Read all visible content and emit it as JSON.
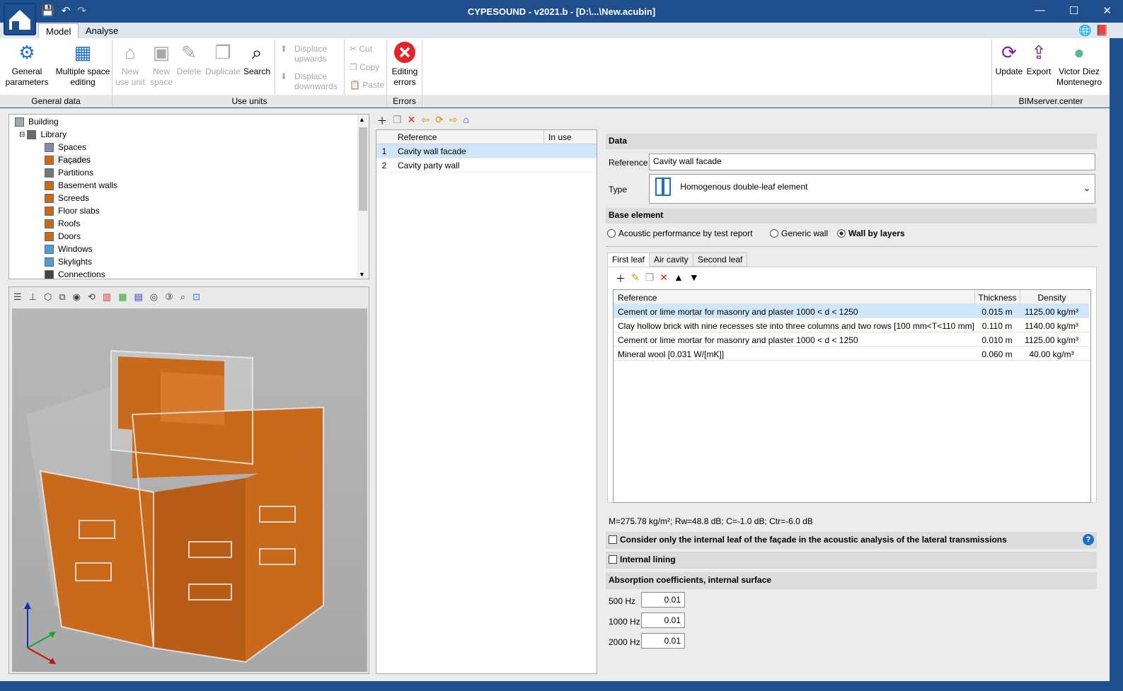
{
  "title": "CYPESOUND - v2021.b - [D:\\...\\New.acubin]",
  "window_buttons": {
    "minimize": "—",
    "maximize": "☐",
    "close": "✕"
  },
  "ribbon_tabs": [
    "Model",
    "Analyse"
  ],
  "ribbon": {
    "general_parameters": "General parameters",
    "multiple_space_editing": "Multiple space editing",
    "new_use_unit": "New use unit",
    "new_space": "New space",
    "delete": "Delete",
    "duplicate": "Duplicate",
    "search": "Search",
    "displace_upwards": "Displace upwards",
    "displace_downwards": "Displace downwards",
    "cut": "Cut",
    "copy": "Copy",
    "paste": "Paste",
    "editing_errors": "Editing errors",
    "update": "Update",
    "export": "Export",
    "user": "Victor Diez Montenegro",
    "groups": [
      "General data",
      "Use units",
      "Errors",
      "BIMserver.center"
    ]
  },
  "tree": {
    "root": "Building",
    "library": "Library",
    "items": [
      "Spaces",
      "Façades",
      "Partitions",
      "Basement walls",
      "Screeds",
      "Floor slabs",
      "Roofs",
      "Doors",
      "Windows",
      "Skylights",
      "Connections"
    ]
  },
  "list": {
    "headers": [
      "Reference",
      "In use"
    ],
    "rows": [
      {
        "n": "1",
        "ref": "Cavity wall facade"
      },
      {
        "n": "2",
        "ref": "Cavity party wall"
      }
    ]
  },
  "data": {
    "section": "Data",
    "reference_label": "Reference",
    "reference_value": "Cavity wall facade",
    "type_label": "Type",
    "type_value": "Homogenous double-leaf element",
    "base_section": "Base element",
    "options": [
      "Acoustic performance by test report",
      "Generic wall",
      "Wall by layers"
    ],
    "leaf_tabs": [
      "First leaf",
      "Air cavity",
      "Second leaf"
    ],
    "layer_headers": [
      "Reference",
      "Thickness",
      "Density"
    ],
    "layers": [
      {
        "ref": "Cement or lime mortar for masonry and plaster  1000 < d < 1250",
        "th": "0.015 m",
        "den": "1125.00 kg/m³"
      },
      {
        "ref": "Clay hollow brick with nine recesses ste into three columns and two rows [100 mm<T<110 mm]",
        "th": "0.110 m",
        "den": "1140.00 kg/m³"
      },
      {
        "ref": "Cement or lime mortar for masonry and plaster  1000 < d < 1250",
        "th": "0.010 m",
        "den": "1125.00 kg/m³"
      },
      {
        "ref": "Mineral wool [0.031 W/[mK]]",
        "th": "0.060 m",
        "den": "40.00 kg/m³"
      }
    ],
    "results": "M=275.78 kg/m²;   Rw=48.8 dB;   C=-1.0 dB;   Ctr=-6.0 dB",
    "consider_internal": "Consider only the internal leaf of the façade in the acoustic analysis of the lateral transmissions",
    "internal_lining": "Internal lining",
    "absorption_section": "Absorption coefficients, internal surface",
    "absorption": [
      {
        "f": "500 Hz",
        "v": "0.01"
      },
      {
        "f": "1000 Hz",
        "v": "0.01"
      },
      {
        "f": "2000 Hz",
        "v": "0.01"
      }
    ]
  },
  "colors": {
    "titlebar": "#1f4e8c",
    "selection": "#cfe6fb",
    "model_orange": "#c8691c",
    "error_red": "#e0262b"
  }
}
